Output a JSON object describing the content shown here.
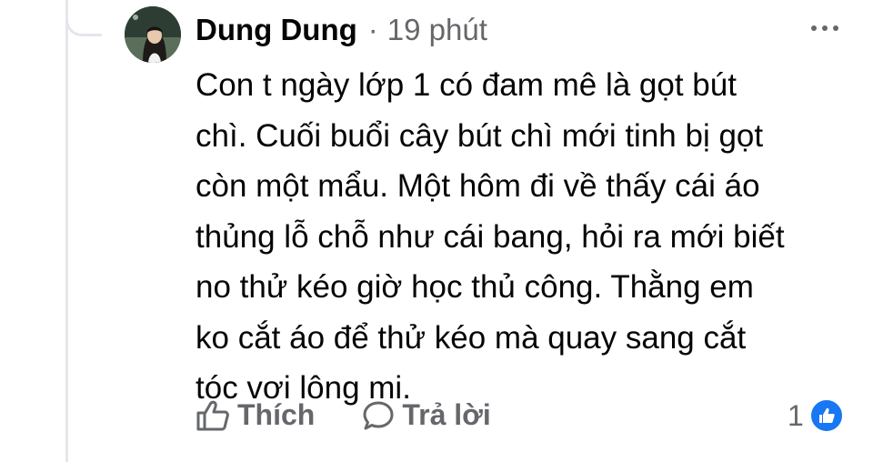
{
  "comment": {
    "author": "Dung Dung",
    "separator": "·",
    "time": "19 phút",
    "lines": [
      "Con t ngày lớp 1 có đam mê là gọt bút",
      "chì. Cuối buổi cây bút chì mới tinh bị gọt",
      "còn một mẩu. Một hôm đi về thấy cái áo",
      "thủng lỗ chỗ như cái bang, hỏi ra mới biết",
      "no thử kéo giờ học thủ công. Thằng em",
      "ko cắt áo để thử kéo mà quay sang cắt",
      "tóc vơi lông mi."
    ]
  },
  "actions": {
    "like_label": "Thích",
    "reply_label": "Trả lời"
  },
  "reactions": {
    "count": "1",
    "icon": "like-reaction-icon",
    "color": "#1877f2"
  },
  "colors": {
    "text": "#050505",
    "secondary": "#65676b",
    "thread_line": "#e4e6eb"
  }
}
